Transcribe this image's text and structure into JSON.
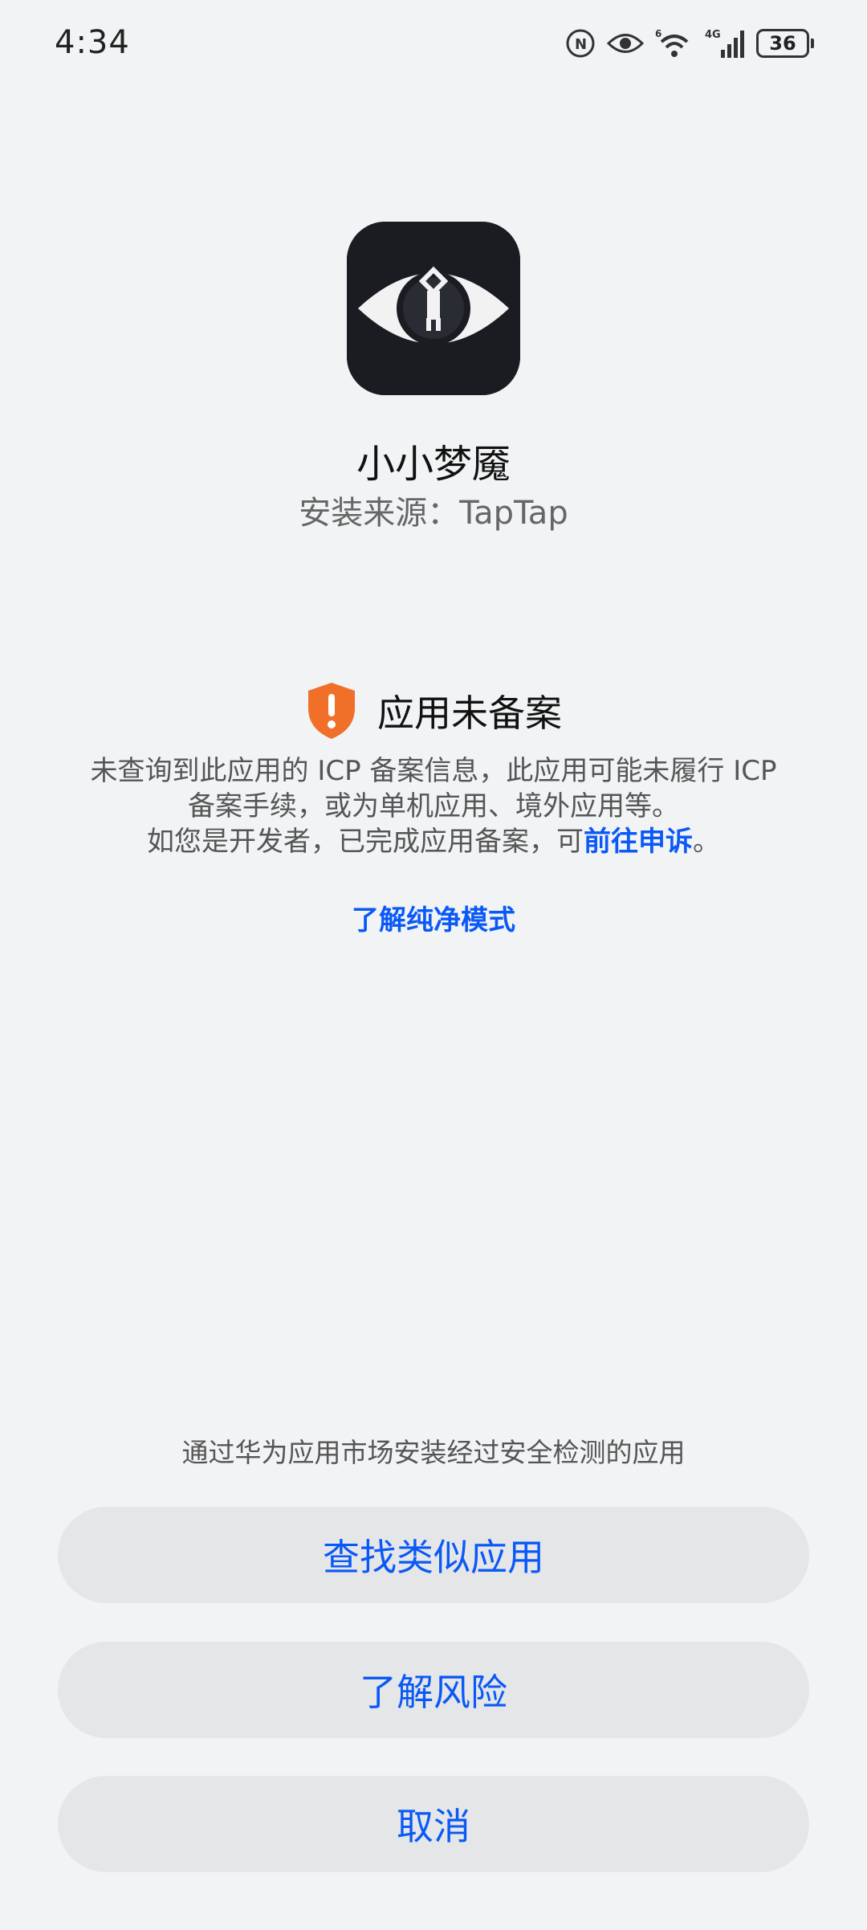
{
  "status_bar": {
    "time": "4:34",
    "battery": "36",
    "signal_label": "4G",
    "wifi_label": "6"
  },
  "app": {
    "name": "小小梦魇",
    "source": "安装来源：TapTap",
    "icon": "little-nightmares-eye-icon"
  },
  "warning": {
    "title": "应用未备案",
    "line1": "未查询到此应用的 ICP 备案信息，此应用可能未履行 ICP",
    "line2": "备案手续，或为单机应用、境外应用等。",
    "line3_prefix": "如您是开发者，已完成应用备案，可",
    "appeal_link": "前往申诉",
    "line3_suffix": "。",
    "learn_link": "了解纯净模式"
  },
  "footer": {
    "hint": "通过华为应用市场安装经过安全检测的应用",
    "find_button": "查找类似应用",
    "risk_button": "了解风险",
    "cancel_button": "取消"
  },
  "colors": {
    "accent": "#0a59f7",
    "background": "#f1f3f5",
    "button_bg": "#e5e6e8",
    "warning_orange": "#f0702a"
  }
}
